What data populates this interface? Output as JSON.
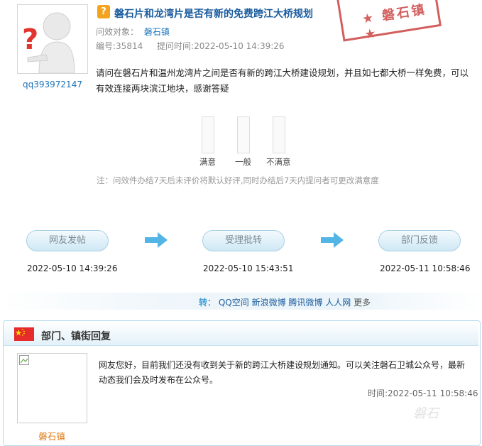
{
  "question": {
    "title": "磐石片和龙湾片是否有新的免费跨江大桥规划",
    "target_label": "问效对象：",
    "target_value": "磐石镇",
    "number_label": "编号:35814",
    "time_label": "提问时间:2022-05-10 14:39:26",
    "username": "qq393972147",
    "content": "请问在磐石片和温州龙湾片之间是否有新的跨江大桥建设规划，并且如七都大桥一样免费，可以有效连接两块滨江地块，感谢答疑",
    "icon": "question-icon",
    "stamp_text": "磐石镇"
  },
  "rating": {
    "options": [
      "满意",
      "一般",
      "不满意"
    ],
    "levels": [
      0,
      0,
      0
    ],
    "note": "注：问效件办结7天后未评价将默认好评,同时办结后7天内提问者可更改满意度"
  },
  "flow": {
    "steps": [
      {
        "label": "网友发帖",
        "time": "2022-05-10 14:39:26"
      },
      {
        "label": "受理批转",
        "time": "2022-05-10 15:43:51"
      },
      {
        "label": "部门反馈",
        "time": "2022-05-11 10:58:46"
      }
    ],
    "arrow_color": "#52b5e6"
  },
  "share": {
    "label": "转：",
    "items": [
      "QQ空间",
      "新浪微博",
      "腾讯微博",
      "人人网"
    ],
    "more": "更多"
  },
  "reply": {
    "section_title": "部门、镇街回复",
    "flag_icon": "china-flag-icon",
    "dept_name": "磐石镇",
    "content": "网友您好，目前我们还没有收到关于新的跨江大桥建设规划通知。可以关注磐石卫城公众号，最新动态我们会及时发布在公众号。",
    "time": "时间:2022-05-11 10:58:46"
  },
  "colors": {
    "title_blue": "#1a5c9e",
    "link_blue": "#1a73b9",
    "stamp_red": "#cc4444",
    "dept_orange": "#e07b16"
  }
}
